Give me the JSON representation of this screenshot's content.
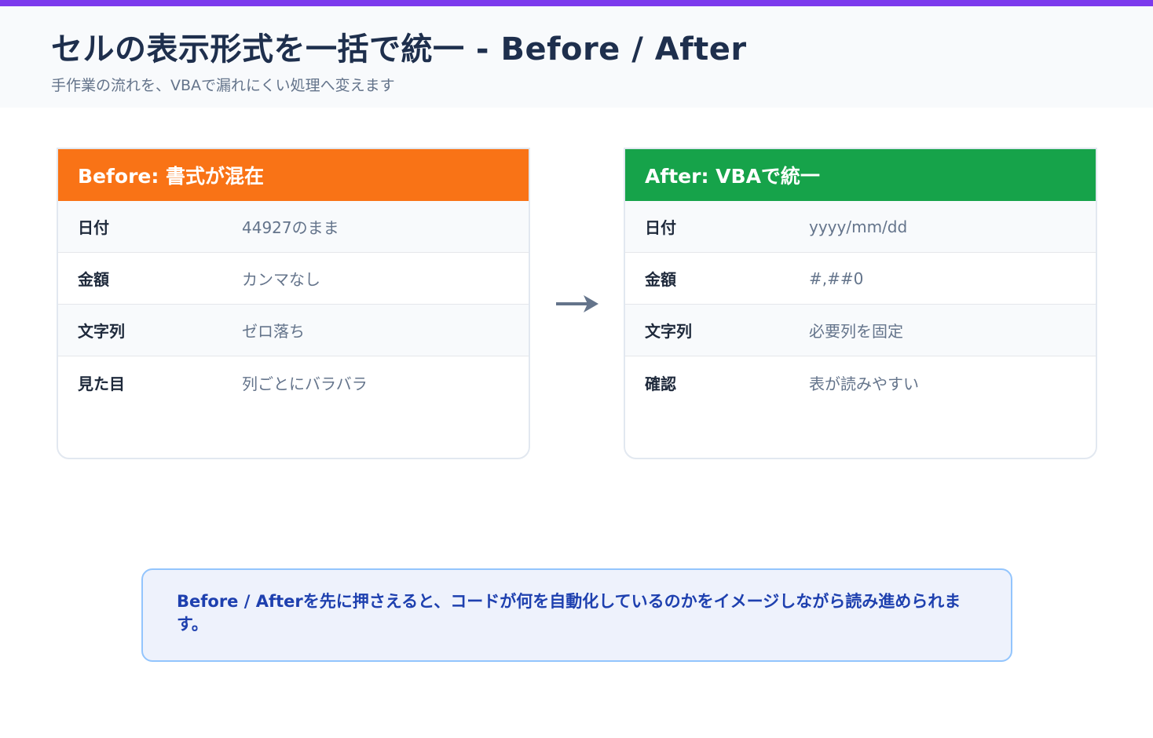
{
  "header": {
    "title": "セルの表示形式を一括で統一 - Before / After",
    "subtitle": "手作業の流れを、VBAで漏れにくい処理へ変えます"
  },
  "before": {
    "heading": "Before: 書式が混在",
    "rows": [
      {
        "label": "日付",
        "value": "44927のまま"
      },
      {
        "label": "金額",
        "value": "カンマなし"
      },
      {
        "label": "文字列",
        "value": "ゼロ落ち"
      },
      {
        "label": "見た目",
        "value": "列ごとにバラバラ"
      }
    ]
  },
  "after": {
    "heading": "After: VBAで統一",
    "rows": [
      {
        "label": "日付",
        "value": "yyyy/mm/dd"
      },
      {
        "label": "金額",
        "value": "#,##0"
      },
      {
        "label": "文字列",
        "value": "必要列を固定"
      },
      {
        "label": "確認",
        "value": "表が読みやすい"
      }
    ]
  },
  "note": {
    "text": "Before / Afterを先に押さえると、コードが何を自動化しているのかをイメージしながら読み進められます。"
  },
  "colors": {
    "accent_bar": "#7c3aed",
    "before_header": "#f97316",
    "after_header": "#16a34a",
    "note_border": "#93c5fd",
    "note_text": "#1e40af",
    "arrow": "#64748b"
  },
  "icons": {
    "flow_arrow": "arrow-right-icon"
  }
}
